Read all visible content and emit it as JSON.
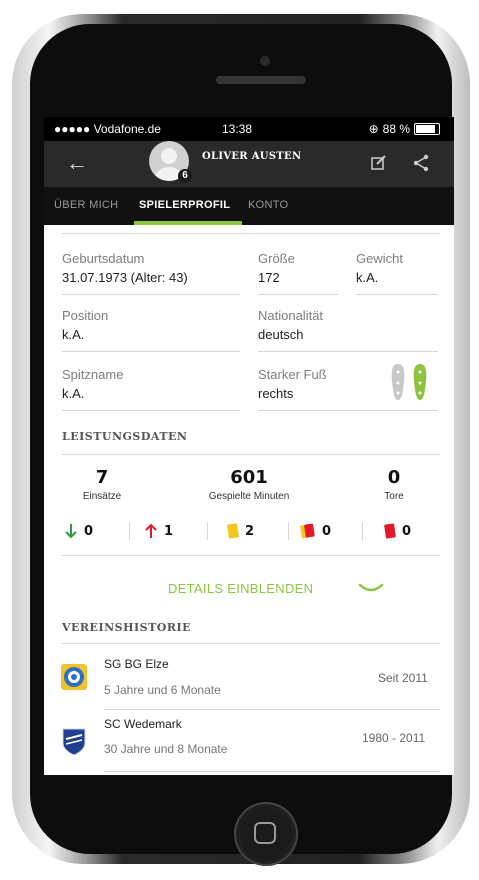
{
  "status_bar": {
    "carrier": "●●●●● Vodafone.de",
    "time": "13:38",
    "battery": "88 %"
  },
  "header": {
    "player_name": "OLIVER AUSTEN",
    "badge": "6"
  },
  "tabs": [
    {
      "label": "ÜBER MICH",
      "active": false
    },
    {
      "label": "SPIELERPROFIL",
      "active": true
    },
    {
      "label": "KONTO",
      "active": false
    }
  ],
  "profile": {
    "birthdate_label": "Geburtsdatum",
    "birthdate": "31.07.1973 (Alter: 43)",
    "height_label": "Größe",
    "height": "172",
    "weight_label": "Gewicht",
    "weight": "k.A.",
    "position_label": "Position",
    "position": "k.A.",
    "nationality_label": "Nationalität",
    "nationality": "deutsch",
    "nickname_label": "Spitzname",
    "nickname": "k.A.",
    "foot_label": "Starker Fuß",
    "foot": "rechts"
  },
  "performance": {
    "title": "LEISTUNGSDATEN",
    "appearances": "7",
    "appearances_label": "Einsätze",
    "minutes": "601",
    "minutes_label": "Gespielte Minuten",
    "goals": "0",
    "goals_label": "Tore",
    "subbed_out": "0",
    "subbed_in": "1",
    "yellow": "2",
    "yellow_red": "0",
    "red": "0",
    "details_label": "DETAILS EINBLENDEN"
  },
  "club_history": {
    "title": "VEREINSHISTORIE",
    "clubs": [
      {
        "name": "SG BG Elze",
        "duration": "5 Jahre und 6 Monate",
        "period": "Seit 2011"
      },
      {
        "name": "SC Wedemark",
        "duration": "30 Jahre und 8 Monate",
        "period": "1980 - 2011"
      }
    ]
  },
  "colors": {
    "accent": "#8bc53f",
    "header_bg": "#2a2a2a",
    "tab_bg": "#111111",
    "yellow_card": "#f5c518",
    "red_card": "#e0192b",
    "arrow_up": "#e0192b",
    "arrow_down": "#2e9e3a"
  }
}
